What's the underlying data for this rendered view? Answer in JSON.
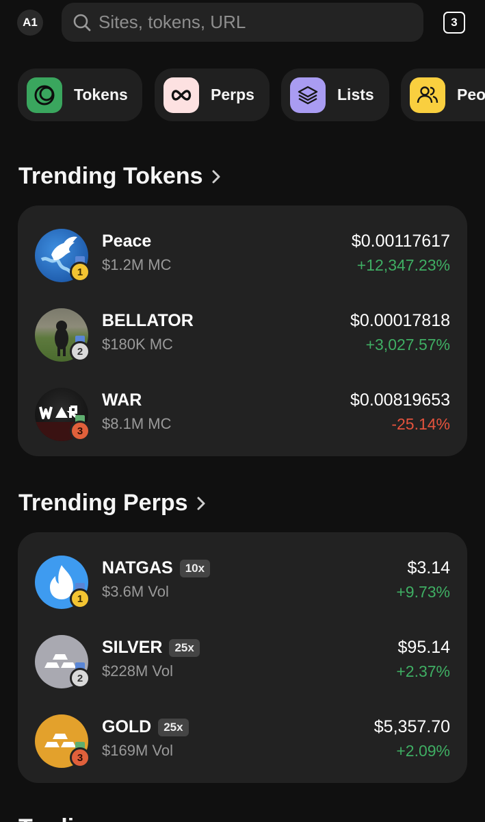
{
  "header": {
    "avatar": "A1",
    "search_placeholder": "Sites, tokens, URL",
    "tabs_count": "3"
  },
  "categories": [
    {
      "label": "Tokens",
      "icon": "tokens-icon",
      "color": "#3aa65e"
    },
    {
      "label": "Perps",
      "icon": "infinity-icon",
      "color": "#fde1e1"
    },
    {
      "label": "Lists",
      "icon": "layers-icon",
      "color": "#a99cf2"
    },
    {
      "label": "Peop",
      "icon": "people-icon",
      "color": "#f9cf3f"
    }
  ],
  "trending_tokens": {
    "title": "Trending Tokens",
    "items": [
      {
        "rank": "1",
        "name": "Peace",
        "sub": "$1.2M MC",
        "price": "$0.00117617",
        "change": "+12,347.23%",
        "direction": "up"
      },
      {
        "rank": "2",
        "name": "BELLATOR",
        "sub": "$180K MC",
        "price": "$0.00017818",
        "change": "+3,027.57%",
        "direction": "up"
      },
      {
        "rank": "3",
        "name": "WAR",
        "sub": "$8.1M MC",
        "price": "$0.00819653",
        "change": "-25.14%",
        "direction": "down"
      }
    ]
  },
  "trending_perps": {
    "title": "Trending Perps",
    "items": [
      {
        "rank": "1",
        "name": "NATGAS",
        "leverage": "10x",
        "sub": "$3.6M Vol",
        "price": "$3.14",
        "change": "+9.73%",
        "direction": "up"
      },
      {
        "rank": "2",
        "name": "SILVER",
        "leverage": "25x",
        "sub": "$228M Vol",
        "price": "$95.14",
        "change": "+2.37%",
        "direction": "up"
      },
      {
        "rank": "3",
        "name": "GOLD",
        "leverage": "25x",
        "sub": "$169M Vol",
        "price": "$5,357.70",
        "change": "+2.09%",
        "direction": "up"
      }
    ]
  },
  "next_section_partial": "Tradi",
  "colors": {
    "background": "#101010",
    "card": "#222222",
    "positive": "#3fae63",
    "negative": "#e5533d",
    "gold_medal": "#f3c432",
    "silver_medal": "#d9d9d9",
    "bronze_medal": "#e0603b"
  }
}
